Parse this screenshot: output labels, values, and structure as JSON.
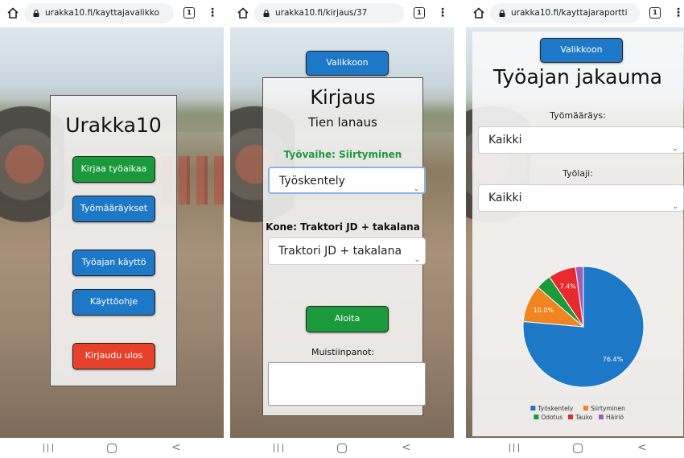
{
  "browser": {
    "url1": "urakka10.fi/kayttajavalikko",
    "url2": "urakka10.fi/kirjaus/37",
    "url3": "urakka10.fi/kayttajaraportti",
    "tab_count": "1"
  },
  "menu_screen": {
    "title": "Urakka10",
    "btn_kirjaa": "Kirjaa työaikaa",
    "btn_tyomaaraykset": "Työmääräykset",
    "btn_tyoajan_kaytto": "Työajan käyttö",
    "btn_kayttoohje": "Käyttöohje",
    "btn_kirjaudu_ulos": "Kirjaudu ulos"
  },
  "entry_screen": {
    "btn_valikkoon": "Valikkoon",
    "title": "Kirjaus",
    "subtitle": "Tien lanaus",
    "work_phase": "Työvaihe: Siirtyminen",
    "phase_select_value": "Työskentely",
    "machine_label": "Kone: Traktori JD + takalana",
    "machine_select_value": "Traktori JD + takalana",
    "btn_aloita": "Aloita",
    "notes_label": "Muistiinpanot:",
    "notes_value": ""
  },
  "report_screen": {
    "btn_valikkoon": "Valikkoon",
    "title": "Työajan jakauma",
    "order_label": "Työmääräys:",
    "order_select_value": "Kaikki",
    "worktype_label": "Työlaji:",
    "worktype_select_value": "Kaikki"
  },
  "colors": {
    "blue": "#1e78c8",
    "green": "#1b9a3c",
    "red": "#e8412b",
    "phase_text": "#1b9a3c"
  },
  "chart_data": {
    "type": "pie",
    "categories": [
      "Työskentely",
      "Siirtyminen",
      "Odotus",
      "Tauko",
      "Häiriö"
    ],
    "values": [
      76.4,
      10.0,
      4.1,
      7.4,
      2.1
    ],
    "data_labels": [
      "76.4%",
      "10.0%",
      "",
      "7.4%",
      ""
    ],
    "colors": [
      "#1e78c8",
      "#f0841e",
      "#1b9a3c",
      "#e82a2e",
      "#9b5fb5"
    ],
    "legend": "bottom"
  }
}
